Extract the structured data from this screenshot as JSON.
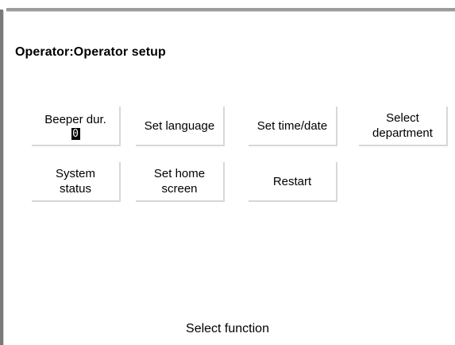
{
  "screen": {
    "title": "Operator:Operator setup",
    "footer": "Select function"
  },
  "buttons": {
    "beeper": {
      "line1": "Beeper dur.",
      "value": "0"
    },
    "set_language": {
      "label": "Set language"
    },
    "set_time_date": {
      "label": "Set time/date"
    },
    "select_department": {
      "line1": "Select",
      "line2": "department"
    },
    "system_status": {
      "line1": "System",
      "line2": "status"
    },
    "set_home_screen": {
      "line1": "Set home",
      "line2": "screen"
    },
    "restart": {
      "label": "Restart"
    }
  },
  "colors": {
    "background": "#ffffff",
    "text": "#000000",
    "button_shadow": "#d7d7d7",
    "frame_border": "#7a7a7a"
  }
}
